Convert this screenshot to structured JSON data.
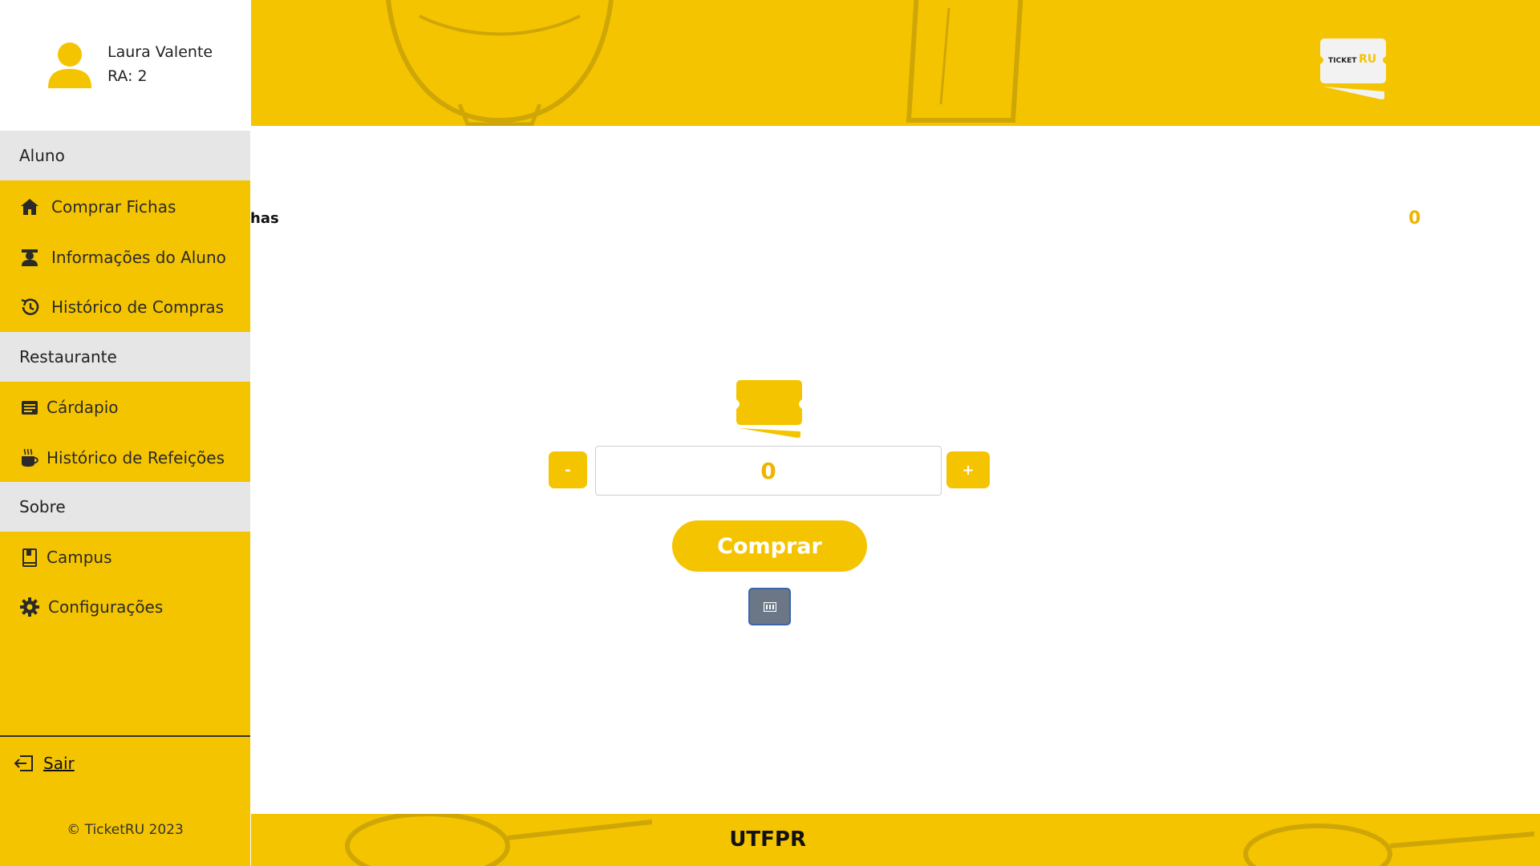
{
  "user": {
    "name": "Laura Valente",
    "ra": "RA: 2"
  },
  "sidebar": {
    "sections": [
      {
        "title": "Aluno",
        "items": [
          {
            "label": "Comprar Fichas",
            "icon": "home-icon"
          },
          {
            "label": "Informações do Aluno",
            "icon": "student-icon"
          },
          {
            "label": "Histórico de Compras",
            "icon": "history-icon"
          }
        ]
      },
      {
        "title": "Restaurante",
        "items": [
          {
            "label": "Cárdapio",
            "icon": "menu-card-icon"
          },
          {
            "label": "Histórico de Refeições",
            "icon": "coffee-icon"
          }
        ]
      },
      {
        "title": "Sobre",
        "items": [
          {
            "label": "Campus",
            "icon": "book-icon"
          },
          {
            "label": "Configurações",
            "icon": "gear-icon"
          }
        ]
      }
    ],
    "logout_label": "Sair",
    "copyright": "© TicketRU 2023"
  },
  "header": {
    "logo_text_a": "TICKET",
    "logo_text_b": "RU"
  },
  "main": {
    "partial_label": "has",
    "ticket_count": "0",
    "quantity": "0",
    "minus_label": "-",
    "plus_label": "+",
    "buy_label": "Comprar"
  },
  "footer": {
    "label": "UTFPR"
  },
  "colors": {
    "accent": "#f5c400",
    "accent_text": "#f0b400",
    "section_bg": "#e6e6e6"
  }
}
